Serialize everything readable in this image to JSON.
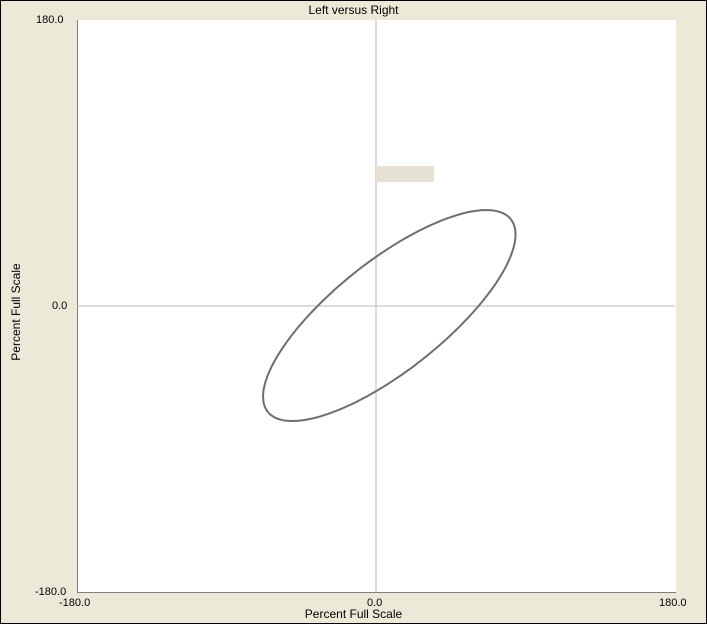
{
  "chart_data": {
    "type": "line",
    "title": "Left versus Right",
    "xlabel": "Percent Full Scale",
    "ylabel": "Percent Full Scale",
    "xlim": [
      -180,
      180
    ],
    "ylim": [
      -180,
      180
    ],
    "x_ticks": [
      "-180.0",
      "0.0",
      "180.0"
    ],
    "y_ticks": [
      "180.0",
      "0.0",
      "-180.0"
    ],
    "grid": "axes-at-zero",
    "legend": "top-center",
    "series": [
      {
        "center": [
          8,
          -6
        ],
        "semi_axes": [
          95,
          34
        ],
        "angle_deg": 40,
        "color": "#6e6e6e"
      }
    ],
    "legend_box_color": "#e6e2d3",
    "axis_line_color": "#b8b8b8"
  }
}
